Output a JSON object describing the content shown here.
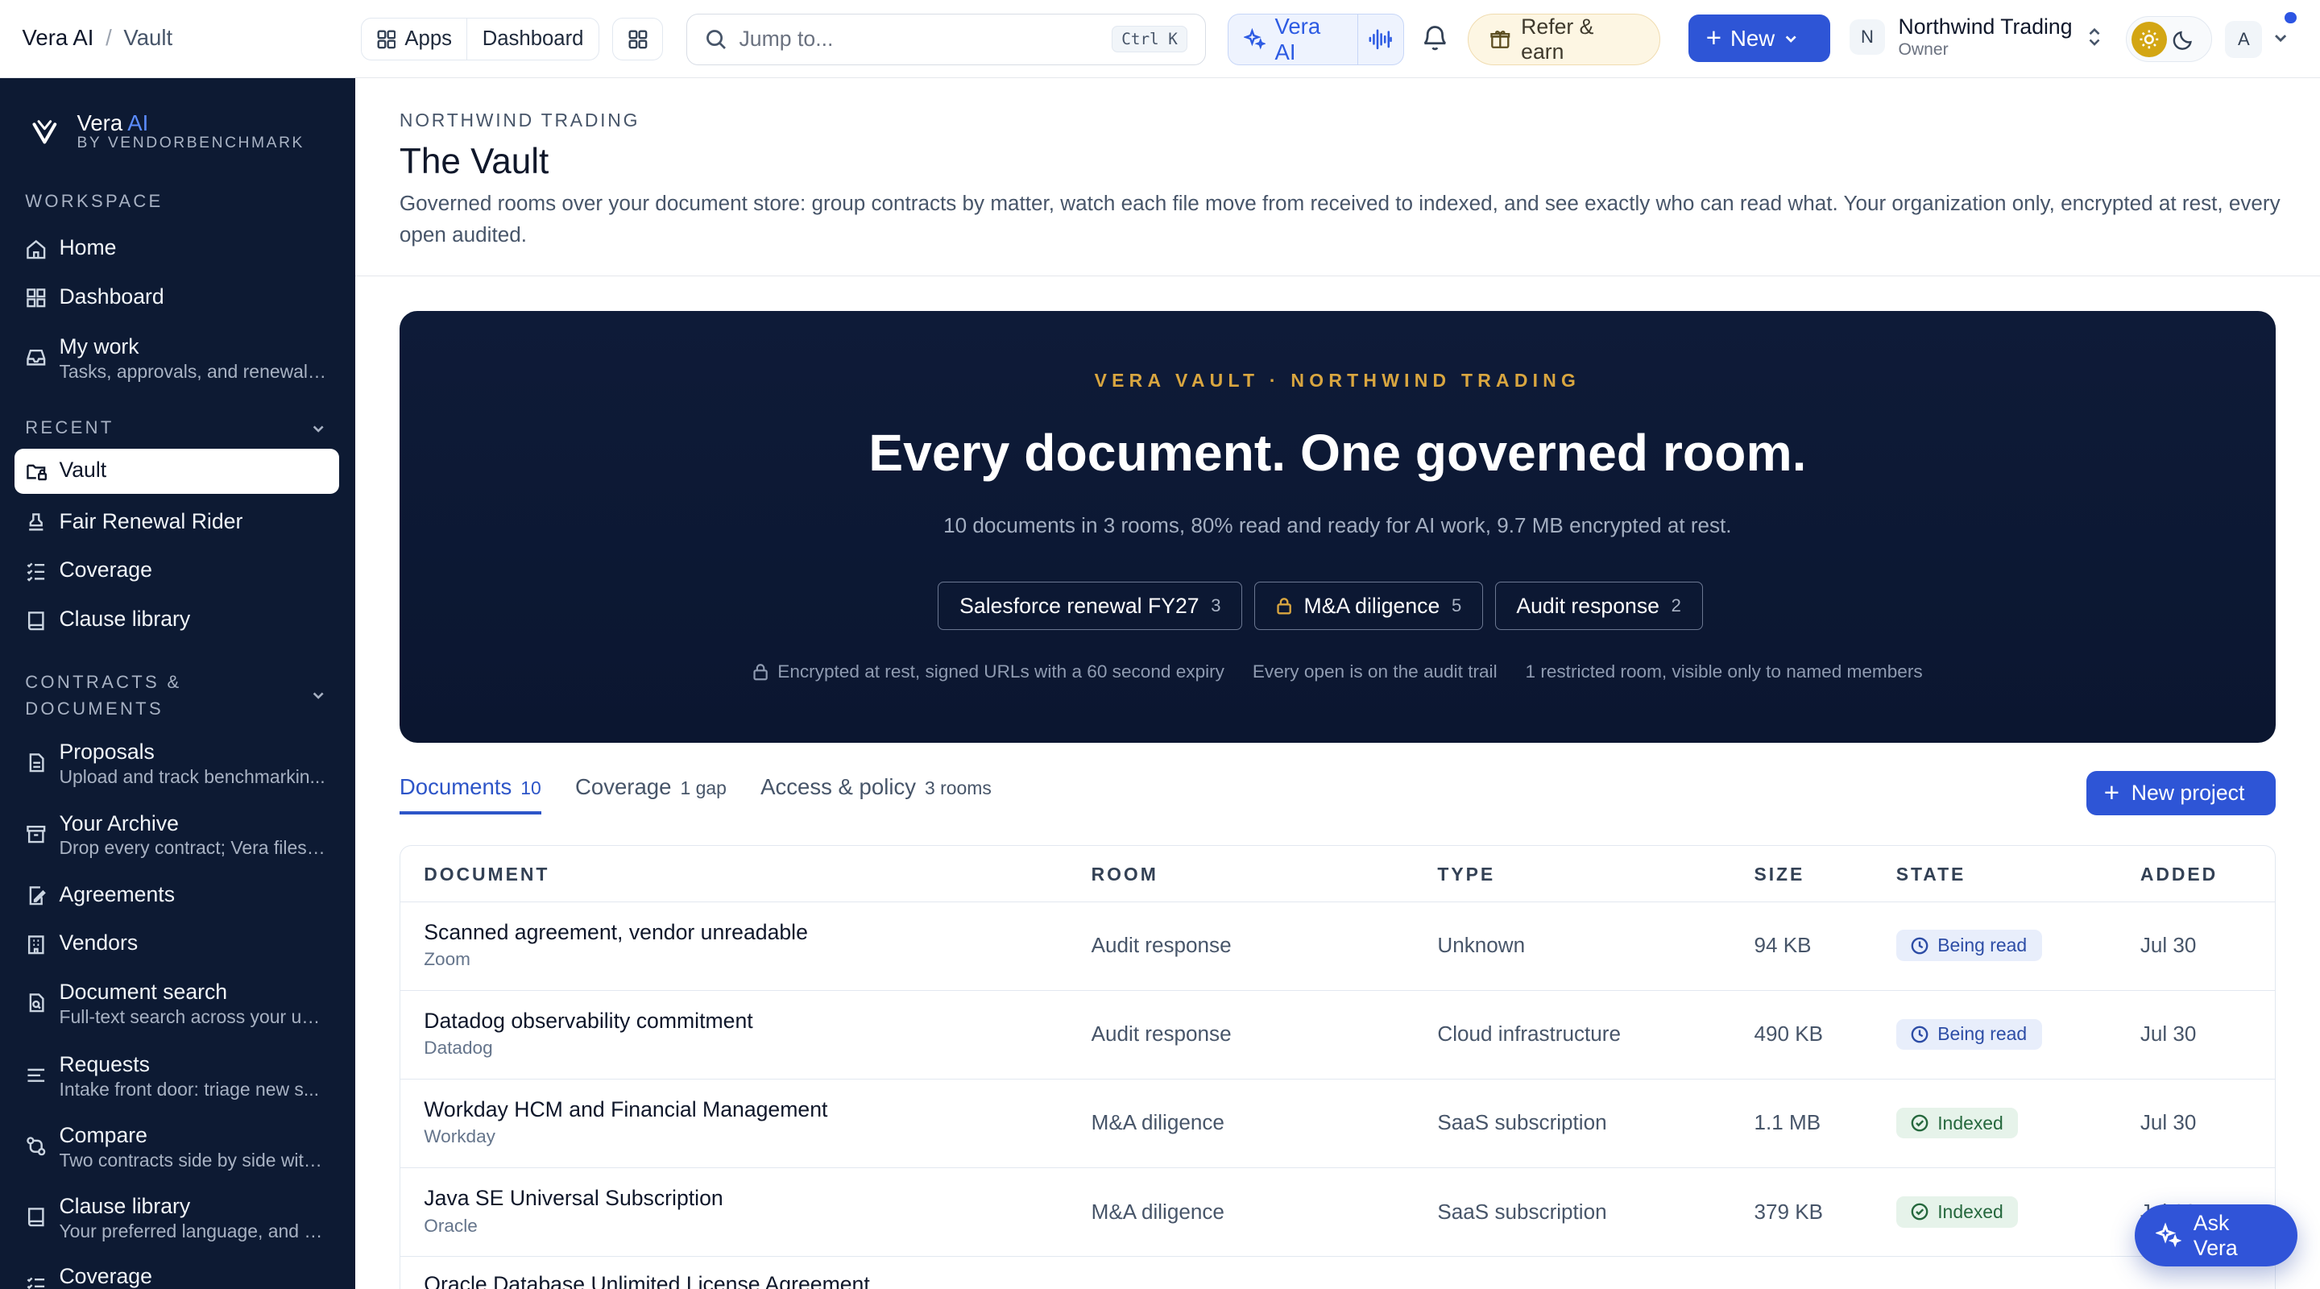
{
  "topbar": {
    "breadcrumb": [
      "Vera AI",
      "Vault"
    ],
    "apps_label": "Apps",
    "dashboard_label": "Dashboard",
    "search_placeholder": "Jump to...",
    "search_shortcut": "Ctrl K",
    "vera_ai_label": "Vera AI",
    "refer_label": "Refer & earn",
    "new_label": "New",
    "org_initial": "N",
    "org_name": "Northwind Trading",
    "org_role": "Owner",
    "user_initial": "A"
  },
  "sidebar": {
    "brand_name": "Vera",
    "brand_ai": "AI",
    "brand_by": "BY VENDORBENCHMARK",
    "workspace_label": "WORKSPACE",
    "workspace_items": [
      {
        "label": "Home",
        "icon": "home-icon"
      },
      {
        "label": "Dashboard",
        "icon": "grid-icon"
      },
      {
        "label": "My work",
        "sub": "Tasks, approvals, and renewals ...",
        "icon": "inbox-icon"
      }
    ],
    "recent_label": "RECENT",
    "recent_items": [
      {
        "label": "Vault",
        "icon": "folder-lock-icon",
        "active": true
      },
      {
        "label": "Fair Renewal Rider",
        "icon": "stamp-icon"
      },
      {
        "label": "Coverage",
        "icon": "list-check-icon"
      },
      {
        "label": "Clause library",
        "icon": "book-icon"
      }
    ],
    "contracts_label_1": "CONTRACTS &",
    "contracts_label_2": "DOCUMENTS",
    "contract_items": [
      {
        "label": "Proposals",
        "sub": "Upload and track benchmarkin...",
        "icon": "file-icon"
      },
      {
        "label": "Your Archive",
        "sub": "Drop every contract; Vera files t...",
        "icon": "archive-icon"
      },
      {
        "label": "Agreements",
        "icon": "file-signature-icon"
      },
      {
        "label": "Vendors",
        "icon": "building-icon"
      },
      {
        "label": "Document search",
        "sub": "Full-text search across your upl...",
        "icon": "file-search-icon"
      },
      {
        "label": "Requests",
        "sub": "Intake front door: triage new s...",
        "icon": "list-icon"
      },
      {
        "label": "Compare",
        "sub": "Two contracts side by side with...",
        "icon": "compare-icon"
      },
      {
        "label": "Clause library",
        "sub": "Your preferred language, and h...",
        "icon": "book-icon"
      },
      {
        "label": "Coverage",
        "icon": "list-check-icon"
      }
    ]
  },
  "header": {
    "org_eyebrow": "NORTHWIND TRADING",
    "title": "The Vault",
    "description": "Governed rooms over your document store: group contracts by matter, watch each file move from received to indexed, and see exactly who can read what. Your organization only, encrypted at rest, every open audited."
  },
  "hero": {
    "eyebrow": "VERA VAULT · NORTHWIND TRADING",
    "headline": "Every document. One governed room.",
    "stats": "10 documents in 3 rooms, 80% read and ready for AI work, 9.7 MB encrypted at rest.",
    "rooms": [
      {
        "name": "Salesforce renewal FY27",
        "count": "3",
        "locked": false
      },
      {
        "name": "M&A diligence",
        "count": "5",
        "locked": true
      },
      {
        "name": "Audit response",
        "count": "2",
        "locked": false
      }
    ],
    "notes": [
      "Encrypted at rest, signed URLs with a 60 second expiry",
      "Every open is on the audit trail",
      "1 restricted room, visible only to named members"
    ]
  },
  "tabs": [
    {
      "label": "Documents",
      "badge": "10",
      "active": true
    },
    {
      "label": "Coverage",
      "badge": "1 gap",
      "active": false
    },
    {
      "label": "Access & policy",
      "badge": "3 rooms",
      "active": false
    }
  ],
  "new_project_label": "New project",
  "table": {
    "columns": [
      "DOCUMENT",
      "ROOM",
      "TYPE",
      "SIZE",
      "STATE",
      "ADDED"
    ],
    "rows": [
      {
        "title": "Scanned agreement, vendor unreadable",
        "vendor": "Zoom",
        "room": "Audit response",
        "type": "Unknown",
        "size": "94 KB",
        "state": "Being read",
        "added": "Jul 30"
      },
      {
        "title": "Datadog observability commitment",
        "vendor": "Datadog",
        "room": "Audit response",
        "type": "Cloud infrastructure",
        "size": "490 KB",
        "state": "Being read",
        "added": "Jul 30"
      },
      {
        "title": "Workday HCM and Financial Management",
        "vendor": "Workday",
        "room": "M&A diligence",
        "type": "SaaS subscription",
        "size": "1.1 MB",
        "state": "Indexed",
        "added": "Jul 30"
      },
      {
        "title": "Java SE Universal Subscription",
        "vendor": "Oracle",
        "room": "M&A diligence",
        "type": "SaaS subscription",
        "size": "379 KB",
        "state": "Indexed",
        "added": "Jul 30"
      },
      {
        "title": "Oracle Database Unlimited License Agreement",
        "vendor": "",
        "room": "",
        "type": "",
        "size": "",
        "state": "",
        "added": ""
      }
    ]
  },
  "ask_vera_label": "Ask Vera",
  "colors": {
    "accent": "#2e55d6",
    "sidebar": "#0d1a33",
    "hero": "#0e1b38",
    "gold": "#d9a640"
  }
}
